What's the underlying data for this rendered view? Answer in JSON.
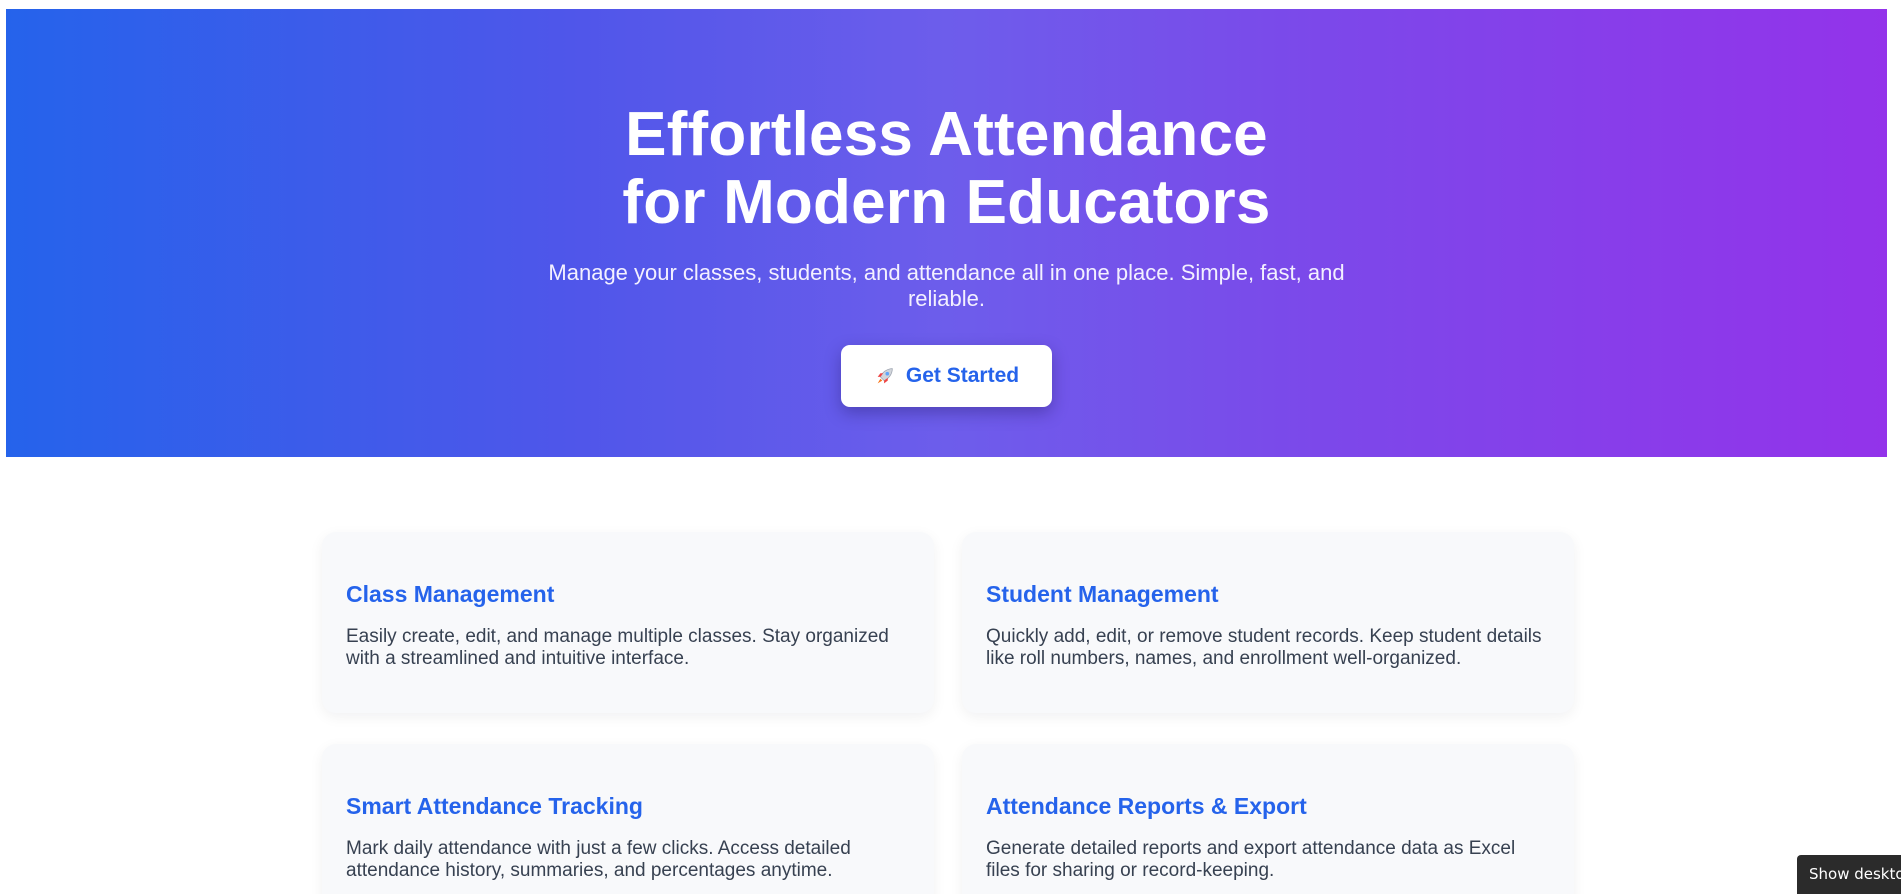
{
  "hero": {
    "title_line1": "Effortless Attendance",
    "title_line2": "for Modern Educators",
    "subtitle": "Manage your classes, students, and attendance all in one place. Simple, fast, and reliable.",
    "cta_label": "Get Started",
    "cta_icon": "rocket-icon"
  },
  "features": [
    {
      "title": "Class Management",
      "description": "Easily create, edit, and manage multiple classes. Stay organized with a streamlined and intuitive interface."
    },
    {
      "title": "Student Management",
      "description": "Quickly add, edit, or remove student records. Keep student details like roll numbers, names, and enrollment well-organized."
    },
    {
      "title": "Smart Attendance Tracking",
      "description": "Mark daily attendance with just a few clicks. Access detailed attendance history, summaries, and percentages anytime."
    },
    {
      "title": "Attendance Reports & Export",
      "description": "Generate detailed reports and export attendance data as Excel files for sharing or record-keeping."
    }
  ],
  "tooltip": {
    "text": "Show desktop"
  },
  "colors": {
    "gradient_start": "#2563eb",
    "gradient_end": "#9333ea",
    "accent": "#2563eb",
    "card_bg": "#f8f9fb",
    "body_text": "#374151"
  }
}
